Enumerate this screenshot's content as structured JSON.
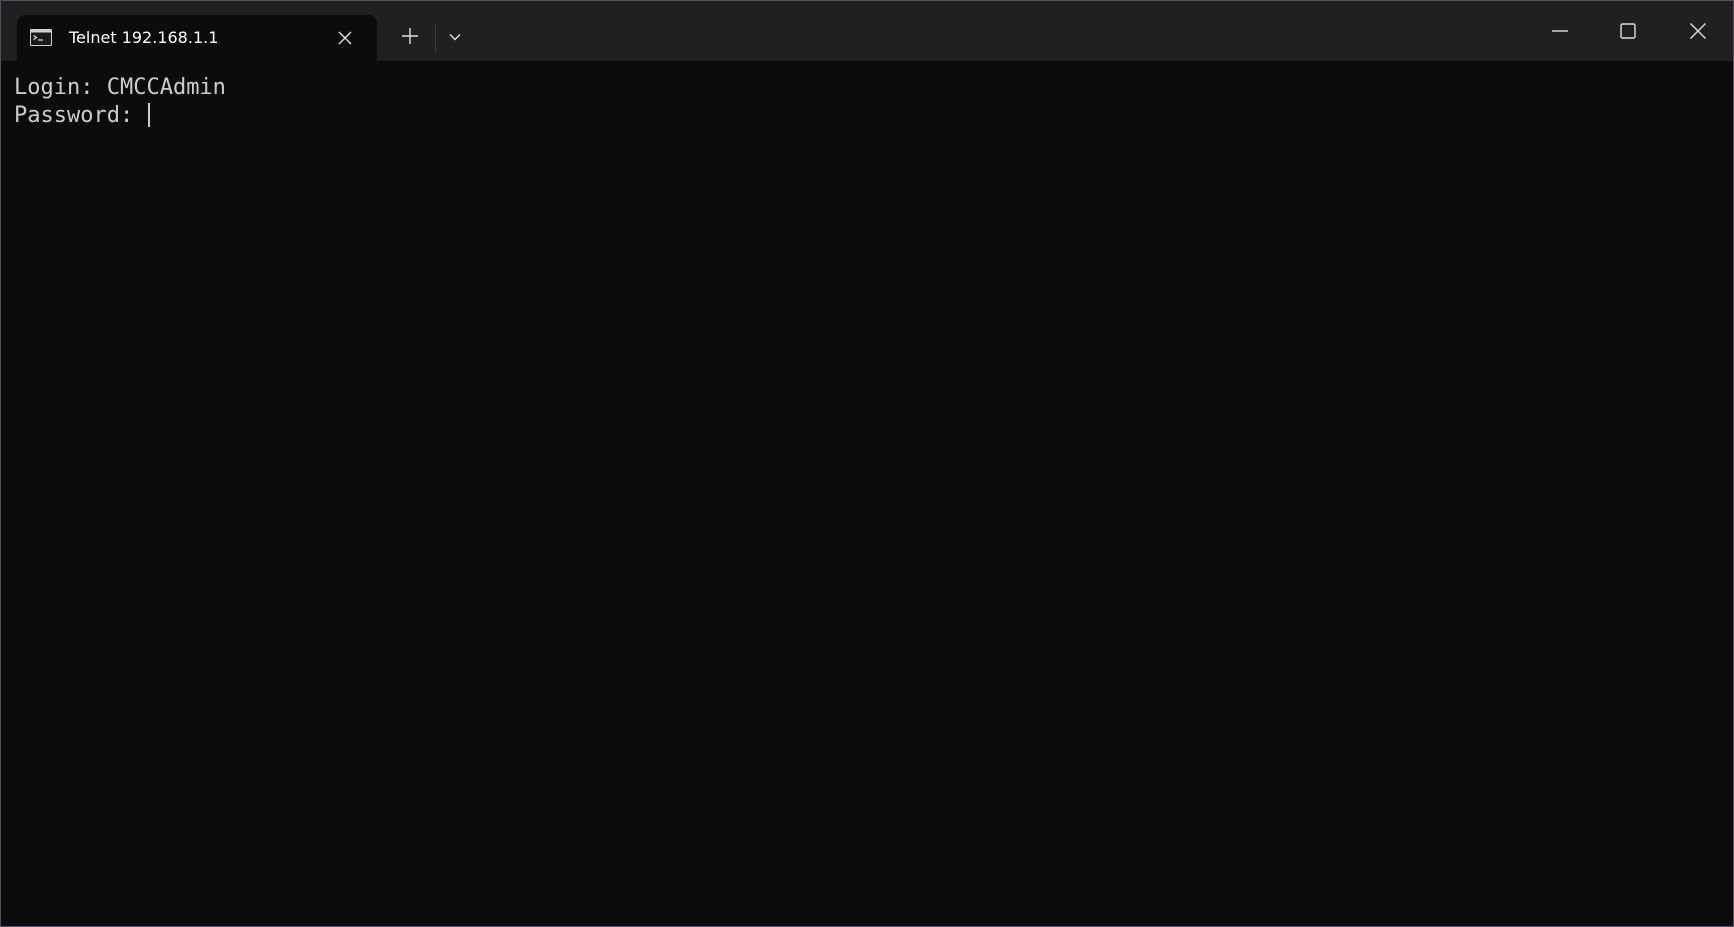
{
  "window": {
    "tab_title": "Telnet 192.168.1.1",
    "tab_icon": "terminal-icon"
  },
  "titlebar": {
    "new_tab_icon": "plus-icon",
    "dropdown_icon": "chevron-down-icon",
    "minimize_icon": "minimize-icon",
    "maximize_icon": "maximize-icon",
    "close_icon": "close-icon"
  },
  "terminal": {
    "login_prompt": "Login: ",
    "login_value": "CMCCAdmin",
    "password_prompt": "Password: "
  },
  "colors": {
    "terminal_background": "#0c0c0c",
    "titlebar_background": "#202020",
    "terminal_text": "#cccccc"
  }
}
